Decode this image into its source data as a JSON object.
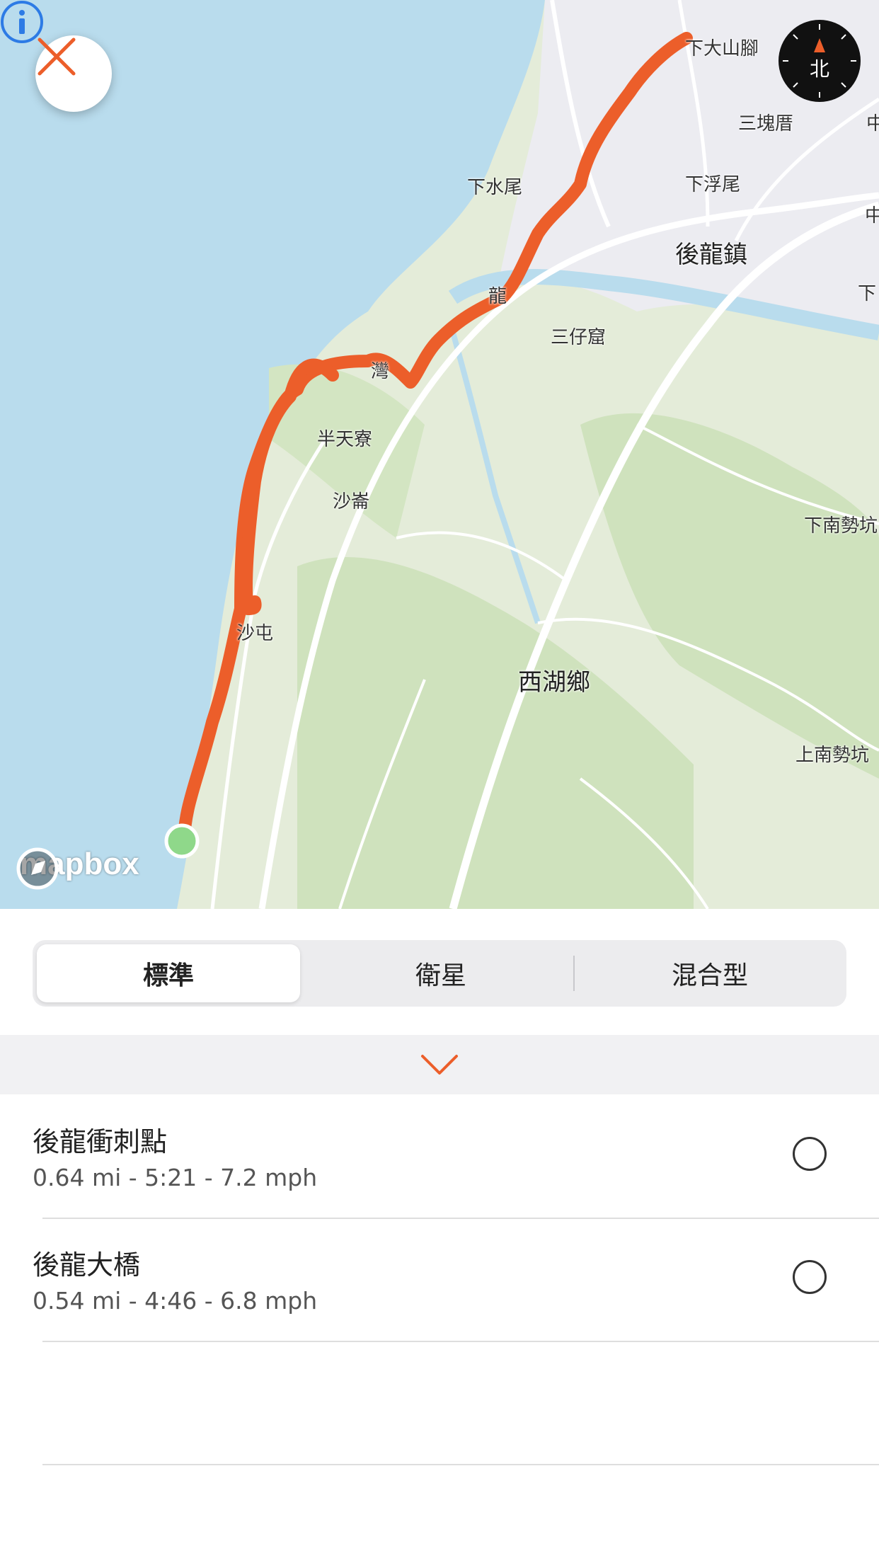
{
  "map": {
    "places": [
      {
        "id": "xiadashanjiao",
        "text": "下大山腳"
      },
      {
        "id": "sankuaicuo",
        "text": "三塊厝"
      },
      {
        "id": "zhong1",
        "text": "中"
      },
      {
        "id": "xiashuiwei",
        "text": "下水尾"
      },
      {
        "id": "xiafuwei",
        "text": "下浮尾"
      },
      {
        "id": "zhong2",
        "text": "中"
      },
      {
        "id": "houlongzhen",
        "text": "後龍鎮"
      },
      {
        "id": "xia",
        "text": "下"
      },
      {
        "id": "long",
        "text": "龍"
      },
      {
        "id": "sanzaiyao",
        "text": "三仔窟"
      },
      {
        "id": "wan",
        "text": "灣"
      },
      {
        "id": "bantianliao",
        "text": "半天寮"
      },
      {
        "id": "shalun",
        "text": "沙崙"
      },
      {
        "id": "xianan",
        "text": "下南勢坑"
      },
      {
        "id": "shatun",
        "text": "沙屯"
      },
      {
        "id": "xihuxiang",
        "text": "西湖鄉"
      },
      {
        "id": "shangnan",
        "text": "上南勢坑"
      }
    ],
    "compass_label": "北",
    "attribution": "mapbox",
    "colors": {
      "route": "#ec5e2a",
      "sea": "#b9dced",
      "land": "#e4ecd9",
      "start_marker": "#8fd88a"
    }
  },
  "map_style": {
    "options": [
      "標準",
      "衛星",
      "混合型"
    ],
    "selected": "標準"
  },
  "segments": [
    {
      "name": "後龍衝刺點",
      "stats": "0.64 mi - 5:21 - 7.2 mph",
      "selected": false
    },
    {
      "name": "後龍大橋",
      "stats": "0.54 mi - 4:46 - 6.8 mph",
      "selected": false
    }
  ]
}
